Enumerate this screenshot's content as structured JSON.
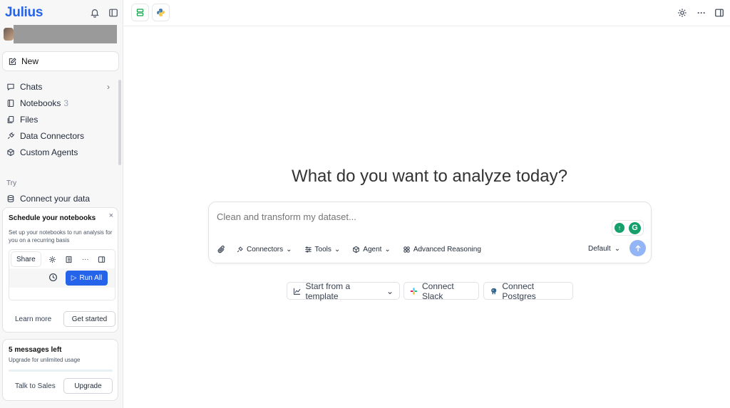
{
  "sidebar": {
    "brand": "Julius",
    "new_label": "New",
    "items": [
      {
        "label": "Chats",
        "count": ""
      },
      {
        "label": "Notebooks",
        "count": "3"
      },
      {
        "label": "Files",
        "count": ""
      },
      {
        "label": "Data Connectors",
        "count": ""
      },
      {
        "label": "Custom Agents",
        "count": ""
      }
    ],
    "try_label": "Try",
    "try_item": "Connect your data",
    "schedule_card": {
      "title": "Schedule your notebooks",
      "close": "×",
      "description": "Set up your notebooks to run analysis for you on a recurring basis",
      "share_label": "Share",
      "run_all_label": "Run All",
      "learn_more": "Learn more",
      "get_started": "Get started"
    },
    "messages_card": {
      "title": "5 messages left",
      "subtitle": "Upgrade for unlimited usage",
      "talk_to_sales": "Talk to Sales",
      "upgrade": "Upgrade"
    }
  },
  "main": {
    "headline": "What do you want to analyze today?",
    "composer": {
      "placeholder": "Clean and transform my dataset...",
      "tools": [
        "Connectors",
        "Tools",
        "Agent",
        "Advanced Reasoning"
      ],
      "model": "Default"
    },
    "chips": [
      "Start from a template",
      "Connect Slack",
      "Connect Postgres"
    ]
  },
  "colors": {
    "accent": "#2563eb",
    "send_button": "#93b4f5",
    "grammarly": "#15a06b"
  }
}
